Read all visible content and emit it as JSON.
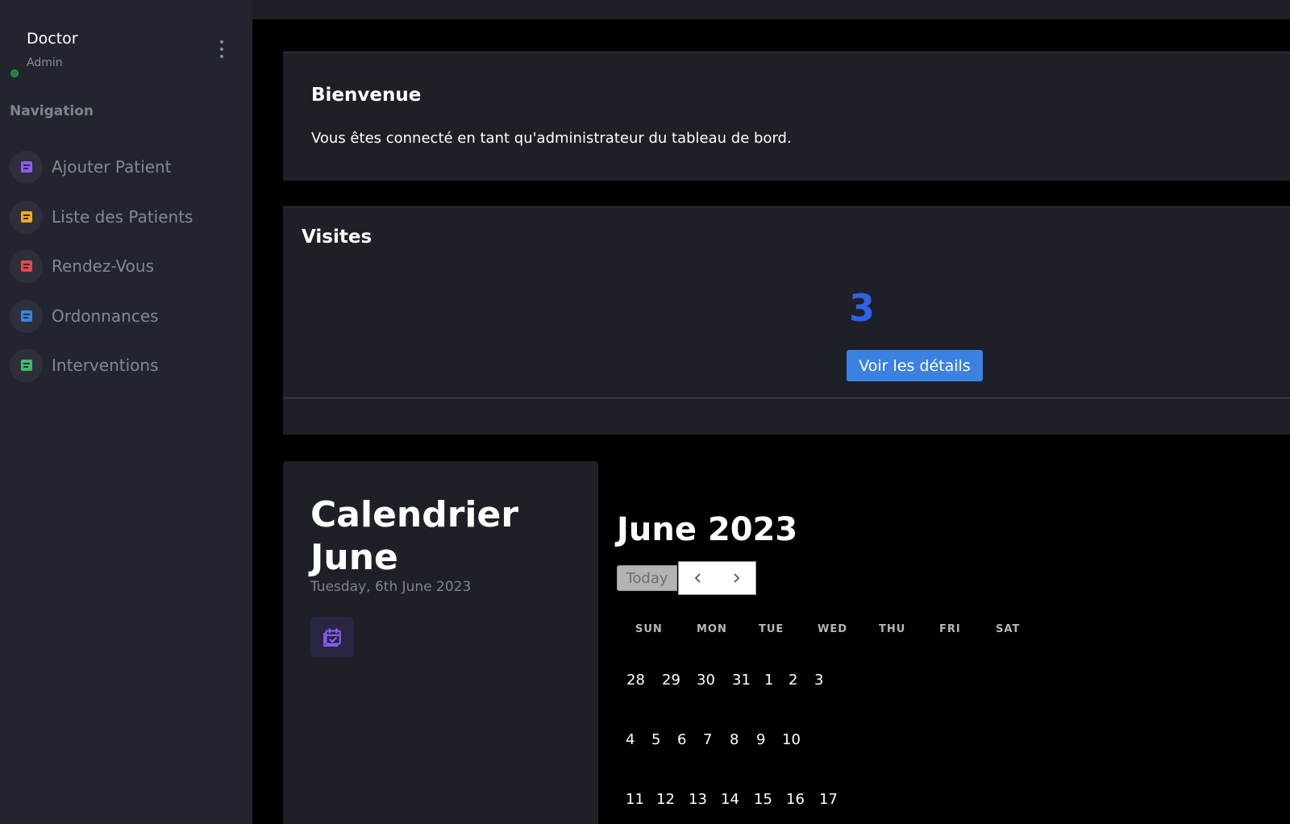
{
  "sidebar": {
    "profile_name": "Doctor",
    "profile_role": "Admin",
    "nav_heading": "Navigation",
    "items": [
      {
        "label": "Ajouter Patient",
        "icon": "document-icon",
        "color": "#8b5cf6"
      },
      {
        "label": "Liste des Patients",
        "icon": "document-icon",
        "color": "#f5a623"
      },
      {
        "label": "Rendez-Vous",
        "icon": "document-icon",
        "color": "#e5484d"
      },
      {
        "label": "Ordonnances",
        "icon": "document-icon",
        "color": "#3b82e0"
      },
      {
        "label": "Interventions",
        "icon": "document-icon",
        "color": "#3fbf6a"
      }
    ]
  },
  "welcome": {
    "title": "Bienvenue",
    "text": "Vous êtes connecté en tant qu'administrateur du tableau de bord."
  },
  "visits": {
    "title": "Visites",
    "count": "3",
    "button_label": "Voir les détails",
    "accent": "#2f62e8"
  },
  "calendar_card": {
    "title_line1": "Calendrier",
    "title_line2": "June",
    "date": "Tuesday, 6th June 2023",
    "icon": "calendar-check-icon"
  },
  "calendar": {
    "month_title": "June 2023",
    "today_label": "Today",
    "weekdays": [
      "SUN",
      "MON",
      "TUE",
      "WED",
      "THU",
      "FRI",
      "SAT"
    ],
    "weeks": [
      [
        "28",
        "29",
        "30",
        "31",
        "1",
        "2",
        "3"
      ],
      [
        "4",
        "5",
        "6",
        "7",
        "8",
        "9",
        "10"
      ],
      [
        "11",
        "12",
        "13",
        "14",
        "15",
        "16",
        "17"
      ]
    ]
  }
}
